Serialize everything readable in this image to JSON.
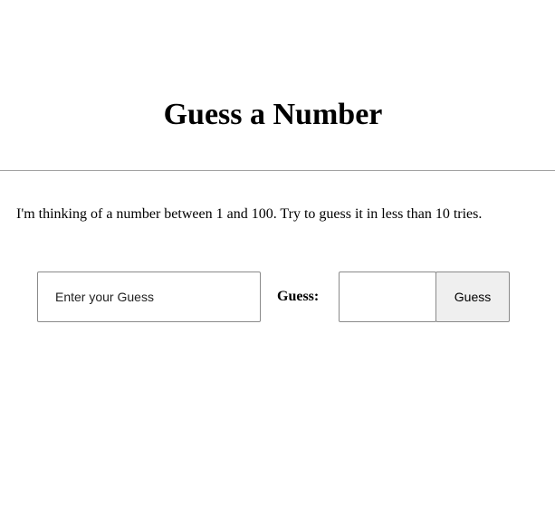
{
  "header": {
    "title": "Guess a Number"
  },
  "main": {
    "instructions": "I'm thinking of a number between 1 and 100. Try to guess it in less than 10 tries.",
    "text_input": {
      "placeholder": "Enter your Guess",
      "value": ""
    },
    "guess_label": "Guess:",
    "number_input": {
      "value": ""
    },
    "guess_button_label": "Guess"
  }
}
